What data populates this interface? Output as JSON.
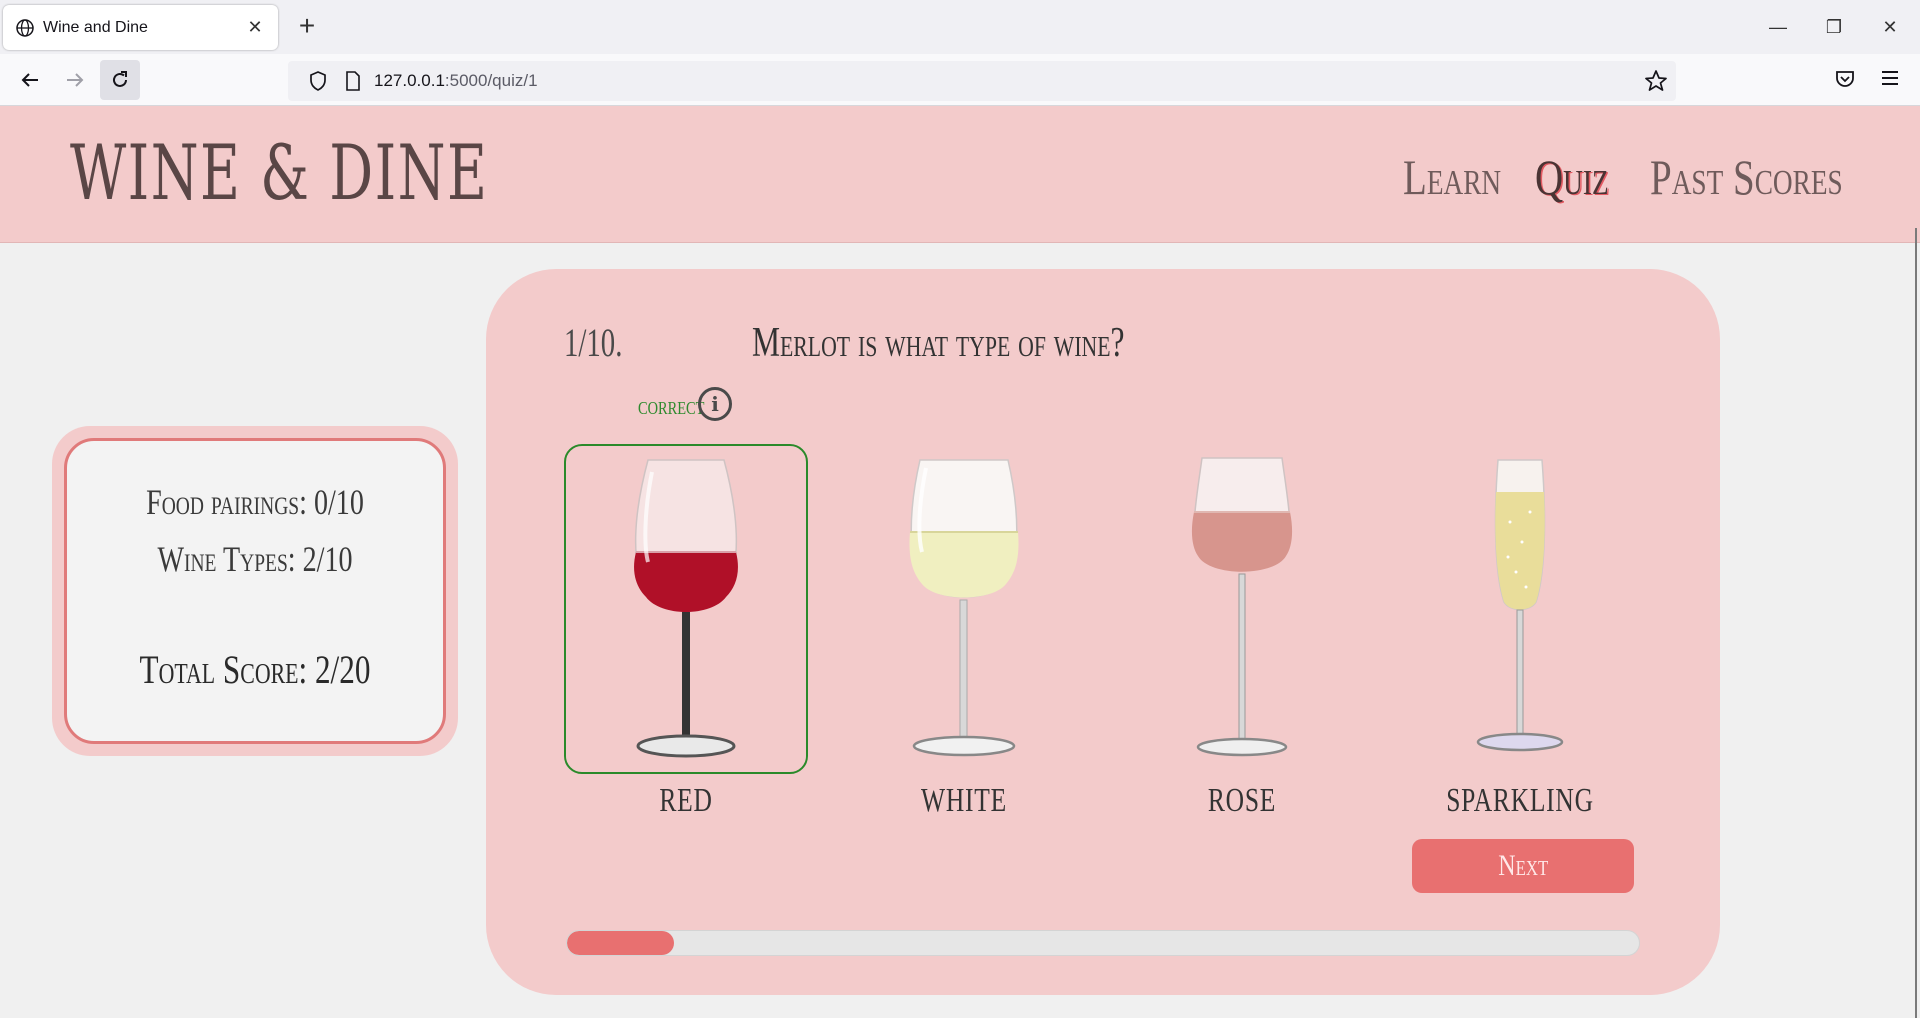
{
  "browser": {
    "tab_title": "Wine and Dine",
    "url_host": "127.0.0.1",
    "url_path": ":5000/quiz/1"
  },
  "site": {
    "logo": "WINE & DINE",
    "nav": [
      {
        "label": "Learn",
        "active": false
      },
      {
        "label": "Quiz",
        "active": true
      },
      {
        "label": "Past Scores",
        "active": false
      }
    ]
  },
  "scores": {
    "food_pairings": "Food pairings:  0/10",
    "wine_types": "Wine Types:  2/10",
    "total": "Total Score:  2/20"
  },
  "quiz": {
    "question_number": "1/10.",
    "question": "Merlot is what type of wine?",
    "feedback": "correct",
    "options": [
      {
        "label": "RED",
        "selected": true
      },
      {
        "label": "WHITE",
        "selected": false
      },
      {
        "label": "ROSE",
        "selected": false
      },
      {
        "label": "SPARKLING",
        "selected": false
      }
    ],
    "next_label": "Next",
    "progress_fraction": 0.1
  },
  "colors": {
    "header_bg": "#f3cbcb",
    "accent": "#e87070",
    "correct": "#2e8a2e"
  }
}
